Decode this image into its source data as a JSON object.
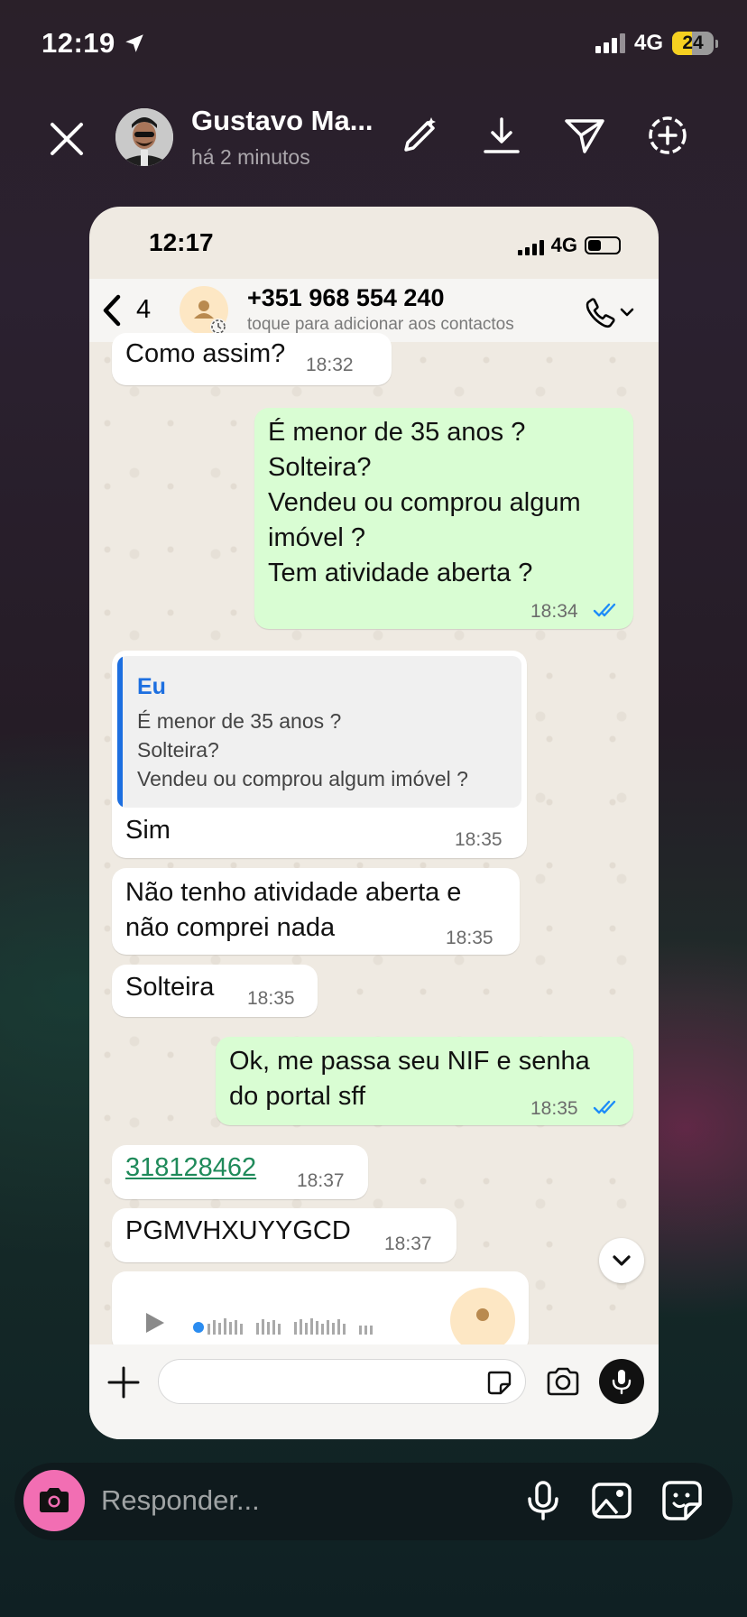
{
  "status_bar": {
    "time": "12:19",
    "network": "4G",
    "battery": "24"
  },
  "story_header": {
    "user_name": "Gustavo Ma...",
    "posted_time": "há 2 minutos"
  },
  "inner_screenshot": {
    "status_bar": {
      "time": "12:17",
      "network": "4G"
    },
    "chat_header": {
      "back_count": "4",
      "contact_name": "+351 968 554 240",
      "contact_subtitle": "toque para adicionar aos contactos"
    },
    "messages": [
      {
        "direction": "in",
        "text": "Como assim?",
        "time": "18:32"
      },
      {
        "direction": "out",
        "text": "É menor de 35 anos ?\nSolteira?\nVendeu ou comprou algum imóvel ?\nTem atividade aberta ?",
        "time": "18:34",
        "read": true
      },
      {
        "direction": "in",
        "reply_to": {
          "author": "Eu",
          "text": "É menor de 35 anos ?\nSolteira?\nVendeu ou comprou algum imóvel ?"
        },
        "text": "Sim",
        "time": "18:35"
      },
      {
        "direction": "in",
        "text": "Não tenho atividade aberta e\nnão comprei nada",
        "time": "18:35"
      },
      {
        "direction": "in",
        "text": "Solteira",
        "time": "18:35"
      },
      {
        "direction": "out",
        "text": "Ok, me passa seu NIF e senha\ndo portal sff",
        "time": "18:35",
        "read": true
      },
      {
        "direction": "in",
        "text": "318128462",
        "time": "18:37",
        "is_link": true
      },
      {
        "direction": "in",
        "text": "PGMVHXUYYGCD",
        "time": "18:37"
      },
      {
        "direction": "in",
        "type": "voice_message"
      }
    ]
  },
  "reply_bar": {
    "placeholder": "Responder..."
  },
  "colors": {
    "outgoing_bubble": "#d9fdd3",
    "incoming_bubble": "#ffffff",
    "read_ticks": "#1d8cf8",
    "camera_button": "#f26eb3",
    "quote_accent": "#1d6fe0",
    "link": "#1f8a5a"
  },
  "icons": [
    "close-icon",
    "draw-icon",
    "download-icon",
    "send-icon",
    "add-story-icon",
    "chevron-left-icon",
    "contact-avatar-icon",
    "phone-icon",
    "chevron-down-icon",
    "plus-icon",
    "sticker-icon",
    "camera-icon",
    "mic-icon",
    "gallery-icon"
  ]
}
